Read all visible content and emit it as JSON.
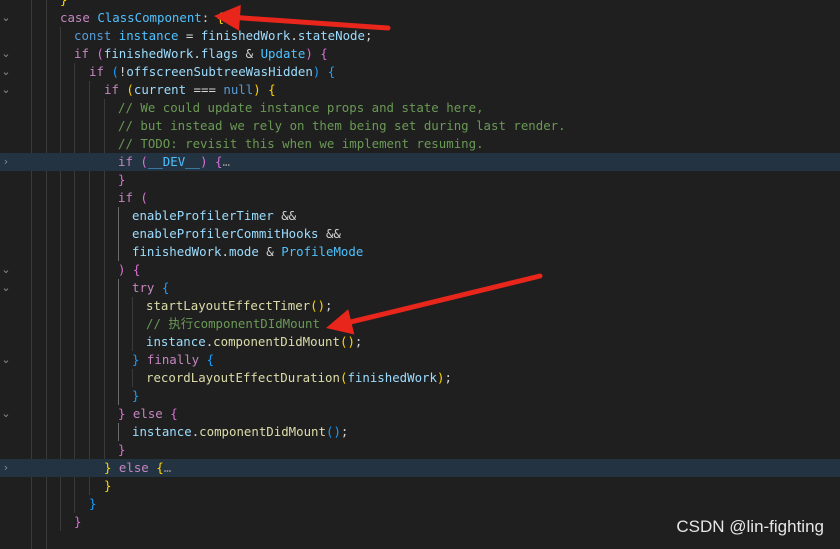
{
  "editor": {
    "lines": [
      {
        "tokens": [
          {
            "t": "}",
            "c": "t-br"
          }
        ],
        "fold": ""
      },
      {
        "tokens": [
          {
            "t": "case ",
            "c": "t-kw"
          },
          {
            "t": "ClassComponent",
            "c": "t-cn"
          },
          {
            "t": ": ",
            "c": "t-op"
          },
          {
            "t": "{",
            "c": "t-br"
          }
        ],
        "fold": "v"
      },
      {
        "tokens": [
          {
            "t": "const ",
            "c": "t-st"
          },
          {
            "t": "instance",
            "c": "t-cn"
          },
          {
            "t": " = ",
            "c": "t-op"
          },
          {
            "t": "finishedWork",
            "c": "t-id"
          },
          {
            "t": ".",
            "c": "t-op"
          },
          {
            "t": "stateNode",
            "c": "t-id"
          },
          {
            "t": ";",
            "c": "t-op"
          }
        ],
        "fold": ""
      },
      {
        "tokens": [
          {
            "t": "if ",
            "c": "t-kw"
          },
          {
            "t": "(",
            "c": "t-pu"
          },
          {
            "t": "finishedWork",
            "c": "t-id"
          },
          {
            "t": ".",
            "c": "t-op"
          },
          {
            "t": "flags",
            "c": "t-id"
          },
          {
            "t": " & ",
            "c": "t-op"
          },
          {
            "t": "Update",
            "c": "t-cn"
          },
          {
            "t": ") ",
            "c": "t-pu"
          },
          {
            "t": "{",
            "c": "t-pu"
          }
        ],
        "fold": "v"
      },
      {
        "tokens": [
          {
            "t": "if ",
            "c": "t-kw"
          },
          {
            "t": "(",
            "c": "t-bb"
          },
          {
            "t": "!",
            "c": "t-op"
          },
          {
            "t": "offscreenSubtreeWasHidden",
            "c": "t-id"
          },
          {
            "t": ") ",
            "c": "t-bb"
          },
          {
            "t": "{",
            "c": "t-bb"
          }
        ],
        "fold": "v"
      },
      {
        "tokens": [
          {
            "t": "if ",
            "c": "t-kw"
          },
          {
            "t": "(",
            "c": "t-br"
          },
          {
            "t": "current",
            "c": "t-id"
          },
          {
            "t": " === ",
            "c": "t-op"
          },
          {
            "t": "null",
            "c": "t-st"
          },
          {
            "t": ") ",
            "c": "t-br"
          },
          {
            "t": "{",
            "c": "t-br"
          }
        ],
        "fold": "v"
      },
      {
        "tokens": [
          {
            "t": "// We could update instance props and state here,",
            "c": "t-cm"
          }
        ],
        "fold": ""
      },
      {
        "tokens": [
          {
            "t": "// but instead we rely on them being set during last render.",
            "c": "t-cm"
          }
        ],
        "fold": ""
      },
      {
        "tokens": [
          {
            "t": "// TODO: revisit this when we implement resuming.",
            "c": "t-cm"
          }
        ],
        "fold": ""
      },
      {
        "tokens": [
          {
            "t": "if ",
            "c": "t-kw"
          },
          {
            "t": "(",
            "c": "t-pu"
          },
          {
            "t": "__DEV__",
            "c": "t-cn"
          },
          {
            "t": ") ",
            "c": "t-pu"
          },
          {
            "t": "{",
            "c": "t-pu"
          },
          {
            "t": "…",
            "c": "t-fo"
          }
        ],
        "fold": ">",
        "hl": true
      },
      {
        "tokens": [
          {
            "t": "}",
            "c": "t-pu"
          }
        ],
        "fold": ""
      },
      {
        "tokens": [
          {
            "t": "if ",
            "c": "t-kw"
          },
          {
            "t": "(",
            "c": "t-pu"
          }
        ],
        "fold": ""
      },
      {
        "tokens": [
          {
            "t": "enableProfilerTimer",
            "c": "t-id"
          },
          {
            "t": " &&",
            "c": "t-op"
          }
        ],
        "fold": ""
      },
      {
        "tokens": [
          {
            "t": "enableProfilerCommitHooks",
            "c": "t-id"
          },
          {
            "t": " &&",
            "c": "t-op"
          }
        ],
        "fold": ""
      },
      {
        "tokens": [
          {
            "t": "finishedWork",
            "c": "t-id"
          },
          {
            "t": ".",
            "c": "t-op"
          },
          {
            "t": "mode",
            "c": "t-id"
          },
          {
            "t": " & ",
            "c": "t-op"
          },
          {
            "t": "ProfileMode",
            "c": "t-cn"
          }
        ],
        "fold": ""
      },
      {
        "tokens": [
          {
            "t": ") ",
            "c": "t-pu"
          },
          {
            "t": "{",
            "c": "t-pu"
          }
        ],
        "fold": "v"
      },
      {
        "tokens": [
          {
            "t": "try ",
            "c": "t-kw"
          },
          {
            "t": "{",
            "c": "t-bb"
          }
        ],
        "fold": "v"
      },
      {
        "tokens": [
          {
            "t": "startLayoutEffectTimer",
            "c": "t-fn"
          },
          {
            "t": "()",
            "c": "t-br"
          },
          {
            "t": ";",
            "c": "t-op"
          }
        ],
        "fold": ""
      },
      {
        "tokens": [
          {
            "t": "// 执行componentDIdMount",
            "c": "t-cm"
          }
        ],
        "fold": ""
      },
      {
        "tokens": [
          {
            "t": "instance",
            "c": "t-id"
          },
          {
            "t": ".",
            "c": "t-op"
          },
          {
            "t": "componentDidMount",
            "c": "t-fn"
          },
          {
            "t": "()",
            "c": "t-br"
          },
          {
            "t": ";",
            "c": "t-op"
          }
        ],
        "fold": ""
      },
      {
        "tokens": [
          {
            "t": "} ",
            "c": "t-bb"
          },
          {
            "t": "finally ",
            "c": "t-kw"
          },
          {
            "t": "{",
            "c": "t-bb"
          }
        ],
        "fold": "v"
      },
      {
        "tokens": [
          {
            "t": "recordLayoutEffectDuration",
            "c": "t-fn"
          },
          {
            "t": "(",
            "c": "t-br"
          },
          {
            "t": "finishedWork",
            "c": "t-id"
          },
          {
            "t": ")",
            "c": "t-br"
          },
          {
            "t": ";",
            "c": "t-op"
          }
        ],
        "fold": ""
      },
      {
        "tokens": [
          {
            "t": "}",
            "c": "t-bb"
          }
        ],
        "fold": ""
      },
      {
        "tokens": [
          {
            "t": "} ",
            "c": "t-pu"
          },
          {
            "t": "else ",
            "c": "t-kw"
          },
          {
            "t": "{",
            "c": "t-pu"
          }
        ],
        "fold": "v"
      },
      {
        "tokens": [
          {
            "t": "instance",
            "c": "t-id"
          },
          {
            "t": ".",
            "c": "t-op"
          },
          {
            "t": "componentDidMount",
            "c": "t-fn"
          },
          {
            "t": "()",
            "c": "t-bb"
          },
          {
            "t": ";",
            "c": "t-op"
          }
        ],
        "fold": ""
      },
      {
        "tokens": [
          {
            "t": "}",
            "c": "t-pu"
          }
        ],
        "fold": ""
      },
      {
        "tokens": [
          {
            "t": "} ",
            "c": "t-br"
          },
          {
            "t": "else ",
            "c": "t-kw"
          },
          {
            "t": "{",
            "c": "t-br"
          },
          {
            "t": "…",
            "c": "t-fo"
          }
        ],
        "fold": ">",
        "hl": true
      },
      {
        "tokens": [
          {
            "t": "}",
            "c": "t-br"
          }
        ],
        "fold": ""
      },
      {
        "tokens": [
          {
            "t": "}",
            "c": "t-bb"
          }
        ],
        "fold": ""
      },
      {
        "tokens": [
          {
            "t": "}",
            "c": "t-pu"
          }
        ],
        "fold": ""
      },
      {
        "tokens": [],
        "fold": ""
      }
    ]
  },
  "watermark": "CSDN @lin-fighting",
  "annotation_color": "#e8261c"
}
